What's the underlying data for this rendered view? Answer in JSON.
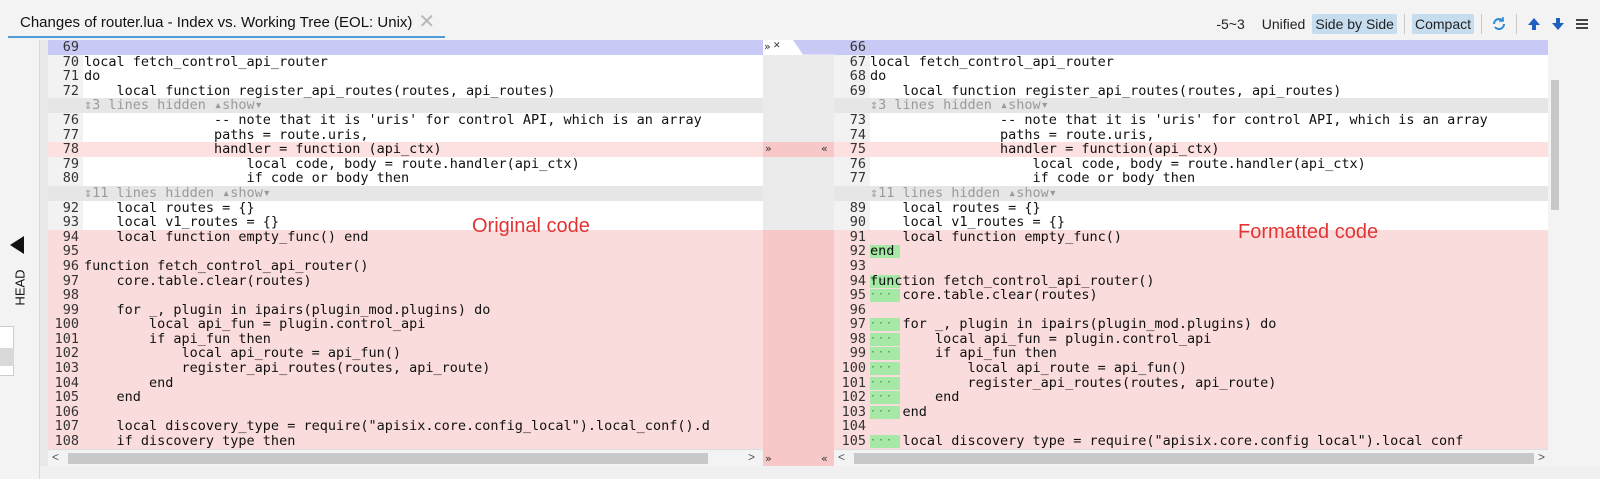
{
  "tab": {
    "title": "Changes of router.lua - Index vs. Working Tree (EOL: Unix)",
    "close_glyph": "✕"
  },
  "toolbar": {
    "count": "-5~3",
    "unified": "Unified",
    "side_by_side": "Side by Side",
    "compact": "Compact",
    "icons": [
      "refresh-icon",
      "arrow-up-icon",
      "arrow-down-icon",
      "menu-icon"
    ]
  },
  "left_strip": {
    "head": "HEAD"
  },
  "annotations": {
    "original": "Original code",
    "formatted": "Formatted code"
  },
  "left": {
    "header_num": "69",
    "rows": [
      {
        "type": "normal",
        "num": "70",
        "code": "local fetch_control_api_router"
      },
      {
        "type": "normal",
        "num": "71",
        "code": "do"
      },
      {
        "type": "normal",
        "num": "72",
        "code": "    local function register_api_routes(routes, api_routes)"
      },
      {
        "type": "hidden",
        "num": "",
        "code": "⇕3 lines hidden ▴show▾"
      },
      {
        "type": "normal",
        "num": "76",
        "code": "                -- note that it is 'uris' for control API, which is an array"
      },
      {
        "type": "normal",
        "num": "77",
        "code": "                paths = route.uris,"
      },
      {
        "type": "mod",
        "num": "78",
        "code": "                handler = function (api_ctx)"
      },
      {
        "type": "normal",
        "num": "79",
        "code": "                    local code, body = route.handler(api_ctx)"
      },
      {
        "type": "normal",
        "num": "80",
        "code": "                    if code or body then"
      },
      {
        "type": "hidden",
        "num": "",
        "code": "⇕11 lines hidden ▴show▾"
      },
      {
        "type": "normal",
        "num": "92",
        "code": "    local routes = {}"
      },
      {
        "type": "normal",
        "num": "93",
        "code": "    local v1_routes = {}"
      },
      {
        "type": "del",
        "num": "94",
        "code": "    local function empty_func() end"
      },
      {
        "type": "del",
        "num": "95",
        "code": ""
      },
      {
        "type": "del",
        "num": "96",
        "code": "function fetch_control_api_router()"
      },
      {
        "type": "del",
        "num": "97",
        "code": "    core.table.clear(routes)"
      },
      {
        "type": "del",
        "num": "98",
        "code": ""
      },
      {
        "type": "del",
        "num": "99",
        "code": "    for _, plugin in ipairs(plugin_mod.plugins) do"
      },
      {
        "type": "del",
        "num": "100",
        "code": "        local api_fun = plugin.control_api"
      },
      {
        "type": "del",
        "num": "101",
        "code": "        if api_fun then"
      },
      {
        "type": "del",
        "num": "102",
        "code": "            local api_route = api_fun()"
      },
      {
        "type": "del",
        "num": "103",
        "code": "            register_api_routes(routes, api_route)"
      },
      {
        "type": "del",
        "num": "104",
        "code": "        end"
      },
      {
        "type": "del",
        "num": "105",
        "code": "    end"
      },
      {
        "type": "del",
        "num": "106",
        "code": ""
      },
      {
        "type": "del",
        "num": "107",
        "code": "    local discovery_type = require(\"apisix.core.config_local\").local_conf().d"
      },
      {
        "type": "del",
        "num": "108",
        "code": "    if discovery type then"
      }
    ]
  },
  "right": {
    "header_num": "66",
    "rows": [
      {
        "type": "normal",
        "num": "67",
        "code": "local fetch_control_api_router",
        "green": false
      },
      {
        "type": "normal",
        "num": "68",
        "code": "do",
        "green": false
      },
      {
        "type": "normal",
        "num": "69",
        "code": "    local function register_api_routes(routes, api_routes)",
        "green": false
      },
      {
        "type": "hidden",
        "num": "",
        "code": "⇕3 lines hidden ▴show▾",
        "green": false
      },
      {
        "type": "normal",
        "num": "73",
        "code": "                -- note that it is 'uris' for control API, which is an array",
        "green": false
      },
      {
        "type": "normal",
        "num": "74",
        "code": "                paths = route.uris,",
        "green": false
      },
      {
        "type": "mod",
        "num": "75",
        "code": "                handler = function(api_ctx)",
        "green": false
      },
      {
        "type": "normal",
        "num": "76",
        "code": "                    local code, body = route.handler(api_ctx)",
        "green": false
      },
      {
        "type": "normal",
        "num": "77",
        "code": "                    if code or body then",
        "green": false
      },
      {
        "type": "hidden",
        "num": "",
        "code": "⇕11 lines hidden ▴show▾",
        "green": false
      },
      {
        "type": "normal",
        "num": "89",
        "code": "    local routes = {}",
        "green": false
      },
      {
        "type": "normal",
        "num": "90",
        "code": "    local v1_routes = {}",
        "green": false
      },
      {
        "type": "del",
        "num": "91",
        "code": "    local function empty_func()",
        "green": false
      },
      {
        "type": "del",
        "num": "92",
        "code": "end",
        "green": true
      },
      {
        "type": "del",
        "num": "93",
        "code": "",
        "green": false
      },
      {
        "type": "del",
        "num": "94",
        "code": "function fetch_control_api_router()",
        "green": true
      },
      {
        "type": "del",
        "num": "95",
        "code": "    core.table.clear(routes)",
        "green": true
      },
      {
        "type": "del",
        "num": "96",
        "code": "",
        "green": false
      },
      {
        "type": "del",
        "num": "97",
        "code": "    for _, plugin in ipairs(plugin_mod.plugins) do",
        "green": true
      },
      {
        "type": "del",
        "num": "98",
        "code": "        local api_fun = plugin.control_api",
        "green": true
      },
      {
        "type": "del",
        "num": "99",
        "code": "        if api_fun then",
        "green": true
      },
      {
        "type": "del",
        "num": "100",
        "code": "            local api_route = api_fun()",
        "green": true
      },
      {
        "type": "del",
        "num": "101",
        "code": "            register_api_routes(routes, api_route)",
        "green": true
      },
      {
        "type": "del",
        "num": "102",
        "code": "        end",
        "green": true
      },
      {
        "type": "del",
        "num": "103",
        "code": "    end",
        "green": true
      },
      {
        "type": "del",
        "num": "104",
        "code": "",
        "green": false
      },
      {
        "type": "del",
        "num": "105",
        "code": "    local discovery type = require(\"apisix.core.config local\").local conf",
        "green": true
      }
    ]
  },
  "middle": {
    "arrow_right": "»",
    "arrow_left": "«",
    "close": "✕"
  },
  "scroll": {
    "left": "<",
    "right": ">"
  },
  "colors": {
    "accent": "#4f9bd7",
    "deleted": "#fbdcdc",
    "added_gutter": "#a6e8a6",
    "header": "#c9c9f5",
    "annotation": "#e33434"
  }
}
